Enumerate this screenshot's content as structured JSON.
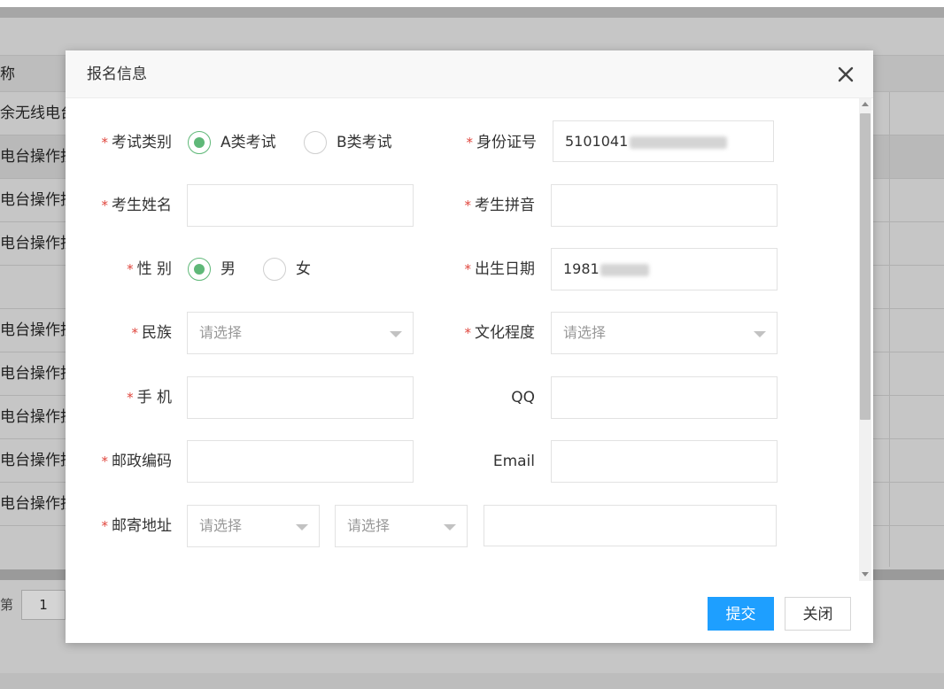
{
  "background": {
    "header_text": "称",
    "rows": [
      "余无线电台",
      "电台操作技",
      "电台操作技",
      "电台操作技",
      "",
      "电台操作技",
      "电台操作技",
      "电台操作技",
      "电台操作技",
      "电台操作技"
    ],
    "pager_label": "第",
    "pager_value": "1"
  },
  "modal": {
    "title": "报名信息",
    "form": {
      "exam_type": {
        "label": "考试类别",
        "options": [
          "A类考试",
          "B类考试"
        ],
        "selected": "A类考试"
      },
      "id_number": {
        "label": "身份证号",
        "value": "5101041"
      },
      "name": {
        "label": "考生姓名",
        "value": ""
      },
      "pinyin": {
        "label": "考生拼音",
        "value": ""
      },
      "gender": {
        "label": "性 别",
        "options": [
          "男",
          "女"
        ],
        "selected": "男"
      },
      "birth_date": {
        "label": "出生日期",
        "value": "1981"
      },
      "ethnicity": {
        "label": "民族",
        "value": "请选择"
      },
      "education": {
        "label": "文化程度",
        "value": "请选择"
      },
      "phone": {
        "label": "手 机",
        "value": ""
      },
      "qq": {
        "label": "QQ",
        "value": ""
      },
      "postcode": {
        "label": "邮政编码",
        "value": ""
      },
      "email": {
        "label": "Email",
        "value": ""
      },
      "address": {
        "label": "邮寄地址",
        "province": "请选择",
        "city": "请选择",
        "detail": ""
      }
    },
    "buttons": {
      "submit": "提交",
      "close": "关闭"
    }
  },
  "colors": {
    "primary": "#1e9fff",
    "radio_checked": "#5fb878",
    "required": "#e0463d"
  }
}
